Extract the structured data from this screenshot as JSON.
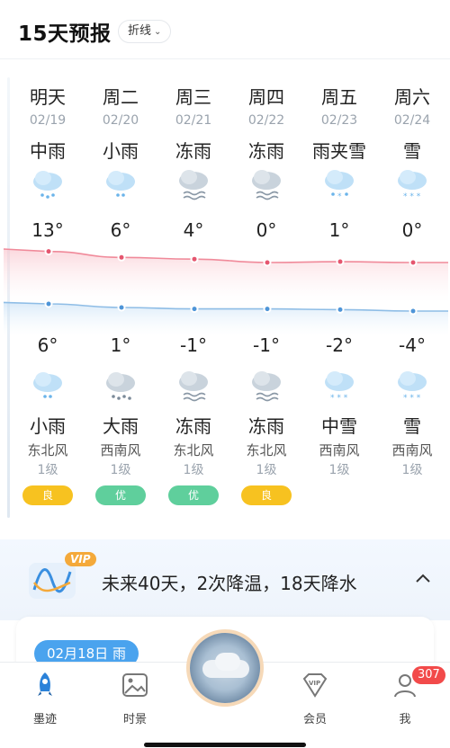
{
  "header": {
    "title": "15天预报",
    "toggle_label": "折线"
  },
  "forecast": {
    "days": [
      {
        "day": "明天",
        "date": "02/19",
        "weather_day": "中雨",
        "high": "13°",
        "low": "6°",
        "weather_night": "小雨",
        "wind_dir": "东北风",
        "wind_level": "1级",
        "aqi": "良",
        "aqi_color": "#f7c220",
        "high_value": 13,
        "low_value": 6
      },
      {
        "day": "周二",
        "date": "02/20",
        "weather_day": "小雨",
        "high": "6°",
        "low": "1°",
        "weather_night": "大雨",
        "wind_dir": "西南风",
        "wind_level": "1级",
        "aqi": "优",
        "aqi_color": "#5fcf9c",
        "high_value": 6,
        "low_value": 1
      },
      {
        "day": "周三",
        "date": "02/21",
        "weather_day": "冻雨",
        "high": "4°",
        "low": "-1°",
        "weather_night": "冻雨",
        "wind_dir": "东北风",
        "wind_level": "1级",
        "aqi": "优",
        "aqi_color": "#5fcf9c",
        "high_value": 4,
        "low_value": -1
      },
      {
        "day": "周四",
        "date": "02/22",
        "weather_day": "冻雨",
        "high": "0°",
        "low": "-1°",
        "weather_night": "冻雨",
        "wind_dir": "东北风",
        "wind_level": "1级",
        "aqi": "良",
        "aqi_color": "#f7c220",
        "high_value": 0,
        "low_value": -1
      },
      {
        "day": "周五",
        "date": "02/23",
        "weather_day": "雨夹雪",
        "high": "1°",
        "low": "-2°",
        "weather_night": "中雪",
        "wind_dir": "西南风",
        "wind_level": "1级",
        "aqi": "",
        "aqi_color": "",
        "high_value": 1,
        "low_value": -2
      },
      {
        "day": "周六",
        "date": "02/24",
        "weather_day": "雪",
        "high": "0°",
        "low": "-4°",
        "weather_night": "雪",
        "wind_dir": "西南风",
        "wind_level": "1级",
        "aqi": "",
        "aqi_color": "",
        "high_value": 0,
        "low_value": -4
      }
    ]
  },
  "promo": {
    "vip_label": "VIP",
    "text": "未来40天，2次降温，18天降水"
  },
  "card": {
    "chip_label": "02月18日 雨"
  },
  "tabbar": {
    "items": [
      {
        "label": "墨迹",
        "icon": "rocket-icon"
      },
      {
        "label": "时景",
        "icon": "image-icon"
      },
      {
        "label": "会员",
        "icon": "vip-diamond-icon"
      },
      {
        "label": "我",
        "icon": "profile-icon",
        "badge": "307"
      }
    ]
  },
  "colors": {
    "high_line": "#f08a9a",
    "low_line": "#8ebde6",
    "accent": "#4aa3ee"
  }
}
